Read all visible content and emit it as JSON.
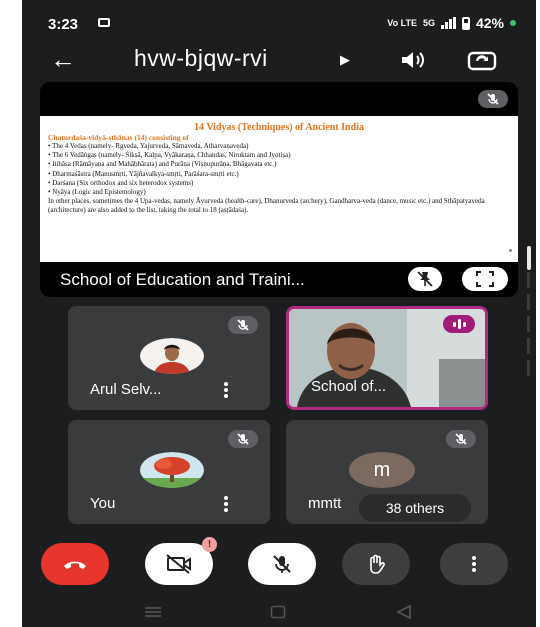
{
  "status": {
    "time": "3:23",
    "signal_label": "Vo LTE",
    "network": "5G",
    "battery": "42%"
  },
  "app": {
    "meeting_code": "hvw-bjqw-rvi"
  },
  "presentation": {
    "slide_title": "14 Vidyas (Techniques) of Ancient India",
    "slide_subtitle": "Chaturdaśa-vidyā-sthānas (14) consisting of",
    "bullets": [
      "The 4 Vedas (namely- Ṛgveda, Yajurveda, Sāmaveda, Atharvaṇaveda)",
      "The 6 Vedāṅgas (namely- Śikṣā, Kalpa, Vyākaraṇa, Chhandas, Niruktam and Jyotiṣa)",
      "Itihāsa (Rāmāyaṇa and Mahābhārata) and Purāṇa (Viṣṇupurāṇa, Bhāgavata etc.)",
      "Dharmaśāstra (Manusmṛti, Yājñavalkya-smṛti, Parāśara-smṛti etc.)",
      "Darśana (Six orthodox and six heterodox systems)",
      "Nyāya (Logic and Epistemology)"
    ],
    "paragraph": "In other places, sometimes the 4 Upa-vedas, namely Āyurveda (health-care), Dhanurveda (archery), Gandharva-veda (dance, music etc.) and Sthāpatyaveda (architecture) are also added to the list, taking the total to 18 (aṣṭādaśa).",
    "presenter": "School of Education and Traini..."
  },
  "participants": [
    {
      "name": "Arul Selv..."
    },
    {
      "name": "School of..."
    },
    {
      "name": "You"
    },
    {
      "name": "mmtt",
      "avatar_letter": "m",
      "others_label": "38 others"
    }
  ],
  "controls": {
    "camera_badge": "!"
  },
  "colors": {
    "end_call": "#e5352c",
    "speaking": "#a11c79"
  }
}
